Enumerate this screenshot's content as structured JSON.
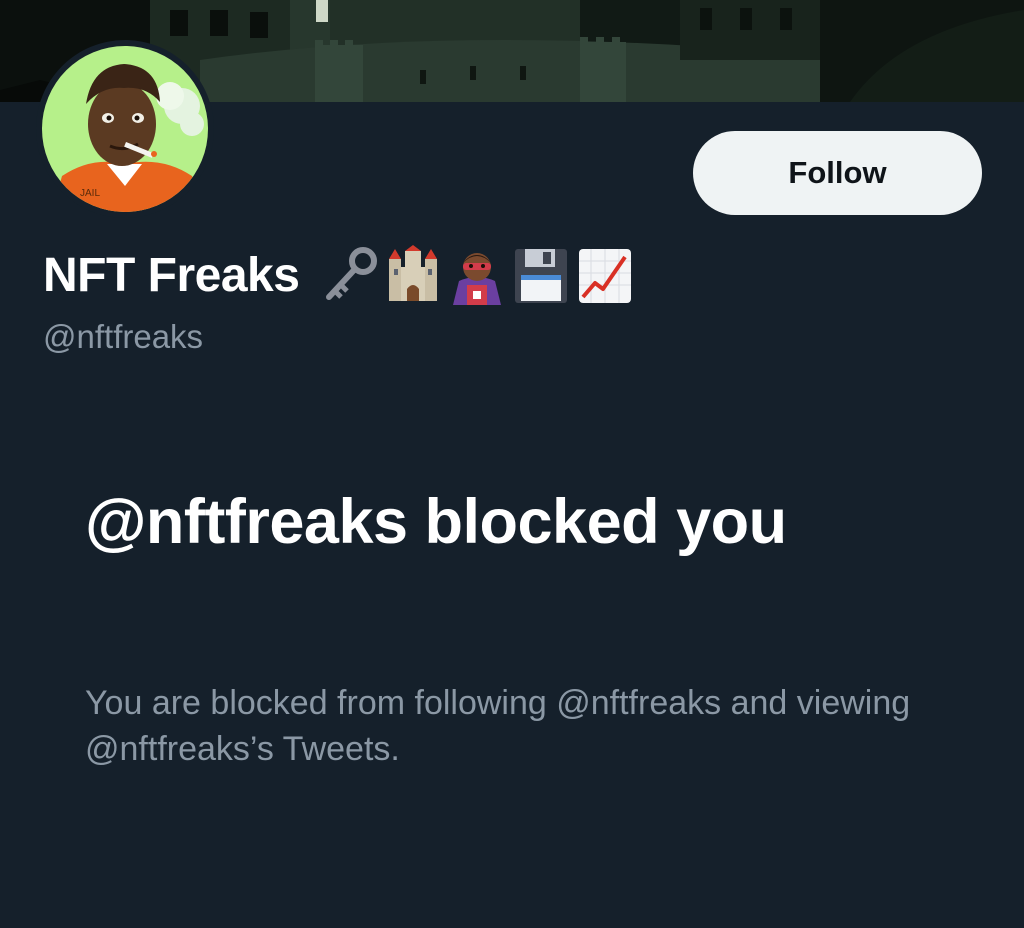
{
  "profile": {
    "display_name": "NFT Freaks",
    "name_emojis": [
      "key-emoji",
      "castle-emoji",
      "superhero-emoji",
      "floppy-disk-emoji",
      "chart-increasing-emoji"
    ],
    "handle": "@nftfreaks"
  },
  "actions": {
    "follow_label": "Follow"
  },
  "blocked": {
    "title": "@nftfreaks blocked you",
    "description": "You are blocked from following @nftfreaks and viewing @nftfreaks’s Tweets."
  },
  "colors": {
    "background": "#15202b",
    "primary_text": "#ffffff",
    "secondary_text": "#8b98a5",
    "button_bg": "#eff3f4",
    "avatar_bg": "#b6f08a",
    "jumpsuit": "#e8641e"
  }
}
